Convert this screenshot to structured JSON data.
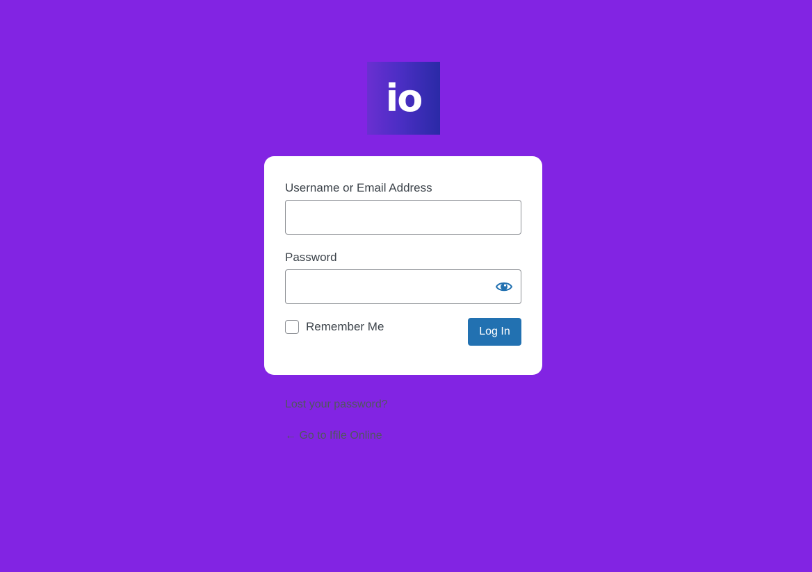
{
  "logo": {
    "text": "io"
  },
  "form": {
    "username_label": "Username or Email Address",
    "username_value": "",
    "password_label": "Password",
    "password_value": "",
    "remember_label": "Remember Me",
    "remember_checked": false,
    "login_button": "Log In"
  },
  "links": {
    "lost_password": "Lost your password?",
    "back_to_site": "← Go to Ifile Online"
  },
  "icons": {
    "password_toggle": "eye-icon"
  },
  "colors": {
    "background": "#8224e3",
    "button": "#2271b1",
    "card": "#ffffff"
  }
}
